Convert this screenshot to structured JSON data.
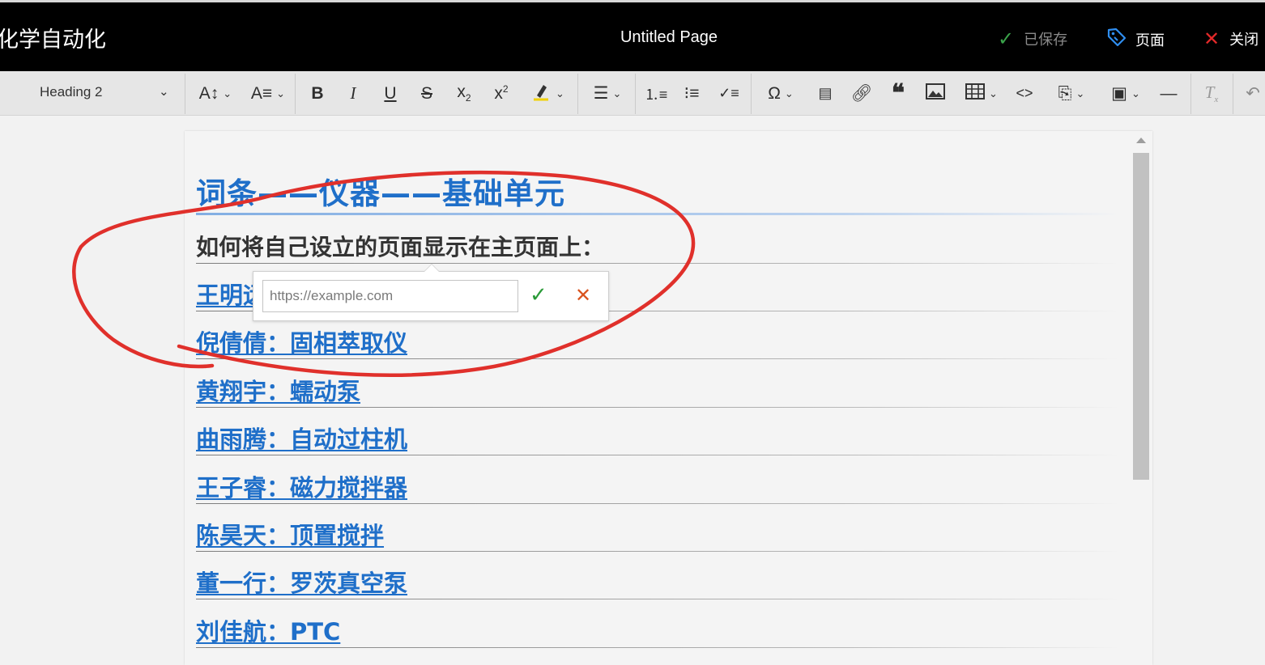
{
  "topbar": {
    "site_title": "化学自动化",
    "page_title": "Untitled Page",
    "saved_label": "已保存",
    "page_label": "页面",
    "close_label": "关闭"
  },
  "toolbar": {
    "heading_style": "Heading 2"
  },
  "document": {
    "h1": "词条——仪器——基础单元",
    "h2": "如何将自己设立的页面显示在主页面上：",
    "links": [
      "王明远",
      "倪倩倩：固相萃取仪",
      "黄翔宇：蠕动泵",
      "曲雨腾：自动过柱机",
      "王子睿：磁力搅拌器",
      "陈昊天：顶置搅拌",
      "董一行：罗茨真空泵",
      "刘佳航：PTC"
    ]
  },
  "link_popup": {
    "placeholder": "https://example.com",
    "value": ""
  },
  "colors": {
    "link": "#1f6fc9",
    "accept": "#2a9a38",
    "cancel": "#d9531e",
    "annotation": "#e0302b"
  }
}
